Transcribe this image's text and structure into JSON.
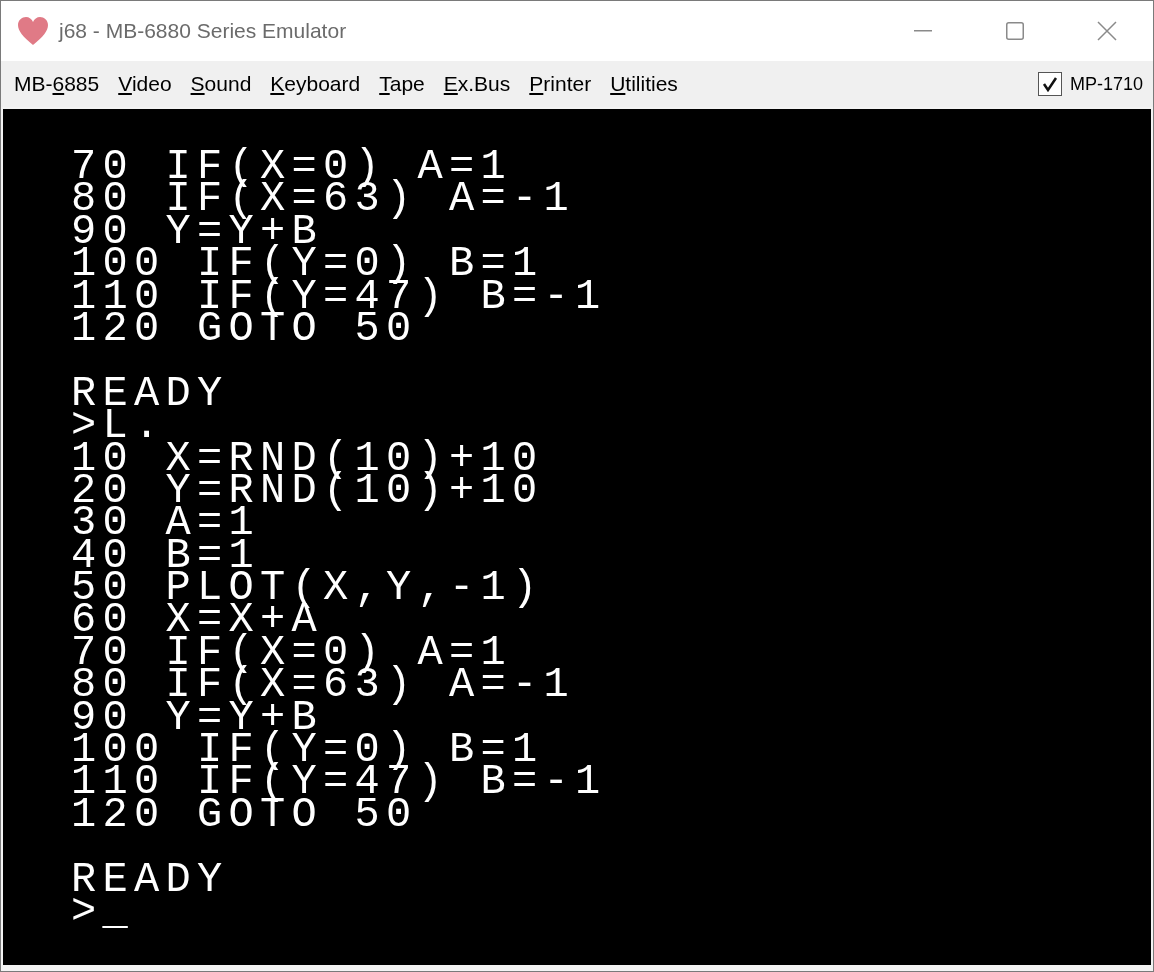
{
  "window": {
    "title": "j68 - MB-6880 Series Emulator"
  },
  "menu": [
    {
      "pre": "MB-",
      "key": "6",
      "post": "885"
    },
    {
      "key": "V",
      "post": "ideo"
    },
    {
      "key": "S",
      "post": "ound"
    },
    {
      "key": "K",
      "post": "eyboard"
    },
    {
      "key": "T",
      "post": "ape"
    },
    {
      "key": "E",
      "post": "x.Bus"
    },
    {
      "key": "P",
      "post": "rinter"
    },
    {
      "key": "U",
      "post": "tilities"
    }
  ],
  "toggle": {
    "label": "MP-1710",
    "checked": true
  },
  "screen": {
    "blocks": [
      [
        "70 IF(X=0) A=1",
        "80 IF(X=63) A=-1",
        "90 Y=Y+B",
        "100 IF(Y=0) B=1",
        "110 IF(Y=47) B=-1",
        "120 GOTO 50"
      ],
      [
        "READY",
        ">L.",
        "10 X=RND(10)+10",
        "20 Y=RND(10)+10",
        "30 A=1",
        "40 B=1",
        "50 PLOT(X,Y,-1)",
        "60 X=X+A",
        "70 IF(X=0) A=1",
        "80 IF(X=63) A=-1",
        "90 Y=Y+B",
        "100 IF(Y=0) B=1",
        "110 IF(Y=47) B=-1",
        "120 GOTO 50"
      ],
      [
        "READY",
        ">_"
      ]
    ]
  }
}
